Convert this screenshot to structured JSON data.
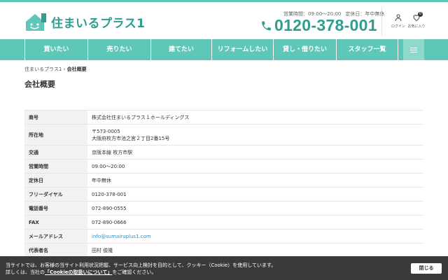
{
  "brand": {
    "name": "住まいるプラス1",
    "color": "#5ec7b8",
    "dark": "#2f9e8f"
  },
  "header": {
    "hours_label": "営業時間：09:00～20:00",
    "holiday_label": "定休日：年中無休",
    "phone": "0120-378-001",
    "login_label": "ログイン",
    "favorites_label": "お気に入り",
    "favorites_count": "0"
  },
  "nav": {
    "items": [
      "買いたい",
      "売りたい",
      "建てたい",
      "リフォームしたい",
      "貸し・借りたい",
      "スタッフ一覧"
    ],
    "menu_icon": "hamburger-icon"
  },
  "breadcrumb": {
    "home": "住まいるプラス1",
    "separator": "›",
    "current": "会社概要"
  },
  "page": {
    "title": "会社概要"
  },
  "company": {
    "rows": [
      {
        "label": "商号",
        "value": "株式会社住まいるプラス１ホールディングス"
      },
      {
        "label": "所在地",
        "value": "〒573-0005",
        "value2": "大阪府枚方市池之宮２丁目2番15号"
      },
      {
        "label": "交通",
        "value": "京阪本線 枚方市駅"
      },
      {
        "label": "営業時間",
        "value": "09:00～20:00"
      },
      {
        "label": "定休日",
        "value": "年中無休"
      },
      {
        "label": "フリーダイヤル",
        "value": "0120-378-001"
      },
      {
        "label": "電話番号",
        "value": "072-890-0555"
      },
      {
        "label": "FAX",
        "value": "072-890-0666"
      },
      {
        "label": "メールアドレス",
        "value": "info@sumairuplus1.com"
      },
      {
        "label": "代表者名",
        "value": "田村 俊隆"
      }
    ]
  },
  "cookie": {
    "line1": "当サイトでは、お客様の当サイト利用状況把握、サービス向上検討を目的として、クッキー（Cookie）を使用しています。",
    "line2_prefix": "詳しくは、当社の",
    "line2_link": "「Cookieの取扱いについて」",
    "line2_suffix": "をご確認ください。",
    "close_label": "閉じる"
  }
}
